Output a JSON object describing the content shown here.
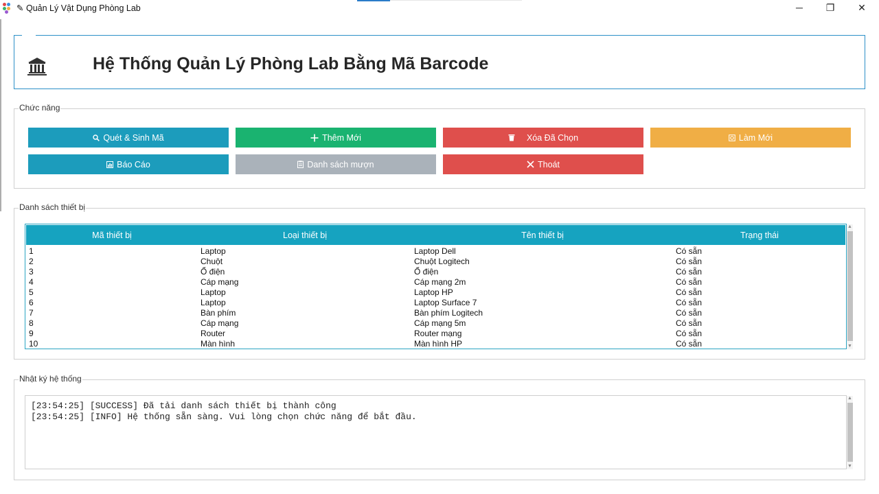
{
  "window": {
    "title": "Quản Lý Vật Dụng Phòng Lab",
    "title_icon": "pencil-icon",
    "controls": {
      "minimize": "─",
      "maximize": "❐",
      "close": "✕"
    }
  },
  "header": {
    "icon": "bank-building-icon",
    "title": "Hệ Thống Quản Lý Phòng Lab Bằng Mã Barcode"
  },
  "functions": {
    "legend": "Chức năng",
    "buttons": [
      {
        "label": "Quét & Sinh Mã",
        "icon": "magnifier-icon",
        "color": "#1c9cbc"
      },
      {
        "label": "Thêm Mới",
        "icon": "plus-icon",
        "color": "#1ab370"
      },
      {
        "label": "Xóa Đã Chọn",
        "icon": "trash-icon",
        "color": "#df4f4c"
      },
      {
        "label": "Làm Mới",
        "icon": "refresh-icon",
        "color": "#f0ae45"
      },
      {
        "label": "Báo Cáo",
        "icon": "bar-chart-icon",
        "color": "#1c9cbc"
      },
      {
        "label": "Danh sách mượn",
        "icon": "clipboard-icon",
        "color": "#aab2ba"
      },
      {
        "label": "Thoát",
        "icon": "close-x-icon",
        "color": "#df4f4c"
      }
    ]
  },
  "devices": {
    "legend": "Danh sách thiết bị",
    "columns": [
      "Mã thiết bị",
      "Loại thiết bị",
      "Tên thiết bị",
      "Trạng thái"
    ],
    "header_color": "#16a3c0",
    "rows": [
      [
        "1",
        "Laptop",
        "Laptop Dell",
        "Có sẵn"
      ],
      [
        "2",
        "Chuột",
        "Chuột Logitech",
        "Có sẵn"
      ],
      [
        "3",
        "Ổ điện",
        "Ổ điện",
        "Có sẵn"
      ],
      [
        "4",
        "Cáp mạng",
        "Cáp mạng 2m",
        "Có sẵn"
      ],
      [
        "5",
        "Laptop",
        "Laptop HP",
        "Có sẵn"
      ],
      [
        "6",
        "Laptop",
        "Laptop Surface 7",
        "Có sẵn"
      ],
      [
        "7",
        "Bàn phím",
        "Bàn phím Logitech",
        "Có sẵn"
      ],
      [
        "8",
        "Cáp mạng",
        "Cáp mạng 5m",
        "Có sẵn"
      ],
      [
        "9",
        "Router",
        "Router mạng",
        "Có sẵn"
      ],
      [
        "10",
        "Màn hình",
        "Màn hình HP",
        "Có sẵn"
      ]
    ]
  },
  "log": {
    "legend": "Nhật ký hệ thống",
    "lines": [
      "[23:54:25] [SUCCESS] Đã tải danh sách thiết bị thành công",
      "[23:54:25] [INFO] Hệ thống sẵn sàng. Vui lòng chọn chức năng để bắt đầu."
    ]
  }
}
